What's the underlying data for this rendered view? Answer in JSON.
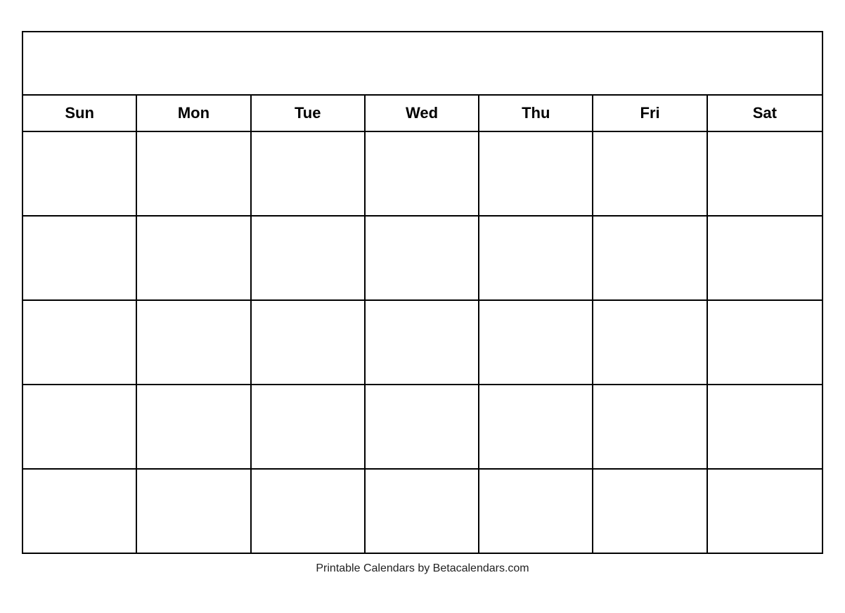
{
  "calendar": {
    "title": "",
    "days": [
      "Sun",
      "Mon",
      "Tue",
      "Wed",
      "Thu",
      "Fri",
      "Sat"
    ],
    "weeks": 5,
    "footer": "Printable Calendars by Betacalendars.com"
  }
}
